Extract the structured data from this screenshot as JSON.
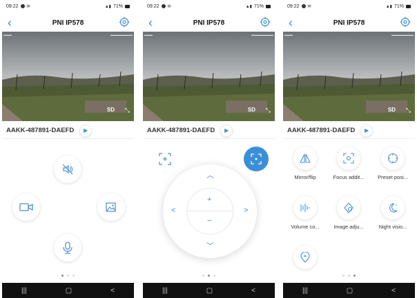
{
  "status": {
    "time": "09:22",
    "battery": "71%"
  },
  "nav": {
    "title": "PNI IP578"
  },
  "video": {
    "quality": "SD"
  },
  "device": {
    "id": "AAKK-487891-DAEFD"
  },
  "grid": {
    "items": [
      {
        "label": "Mirror/flip",
        "icon": "mirror-flip-icon"
      },
      {
        "label": "Focus addit...",
        "icon": "focus-icon"
      },
      {
        "label": "Preset posi...",
        "icon": "preset-icon"
      },
      {
        "label": "Volume co...",
        "icon": "volume-icon"
      },
      {
        "label": "Image adju...",
        "icon": "image-adjust-icon"
      },
      {
        "label": "Night visio...",
        "icon": "night-vision-icon"
      }
    ]
  },
  "colors": {
    "accent": "#3a8fd8",
    "sysnav": "#111111"
  }
}
